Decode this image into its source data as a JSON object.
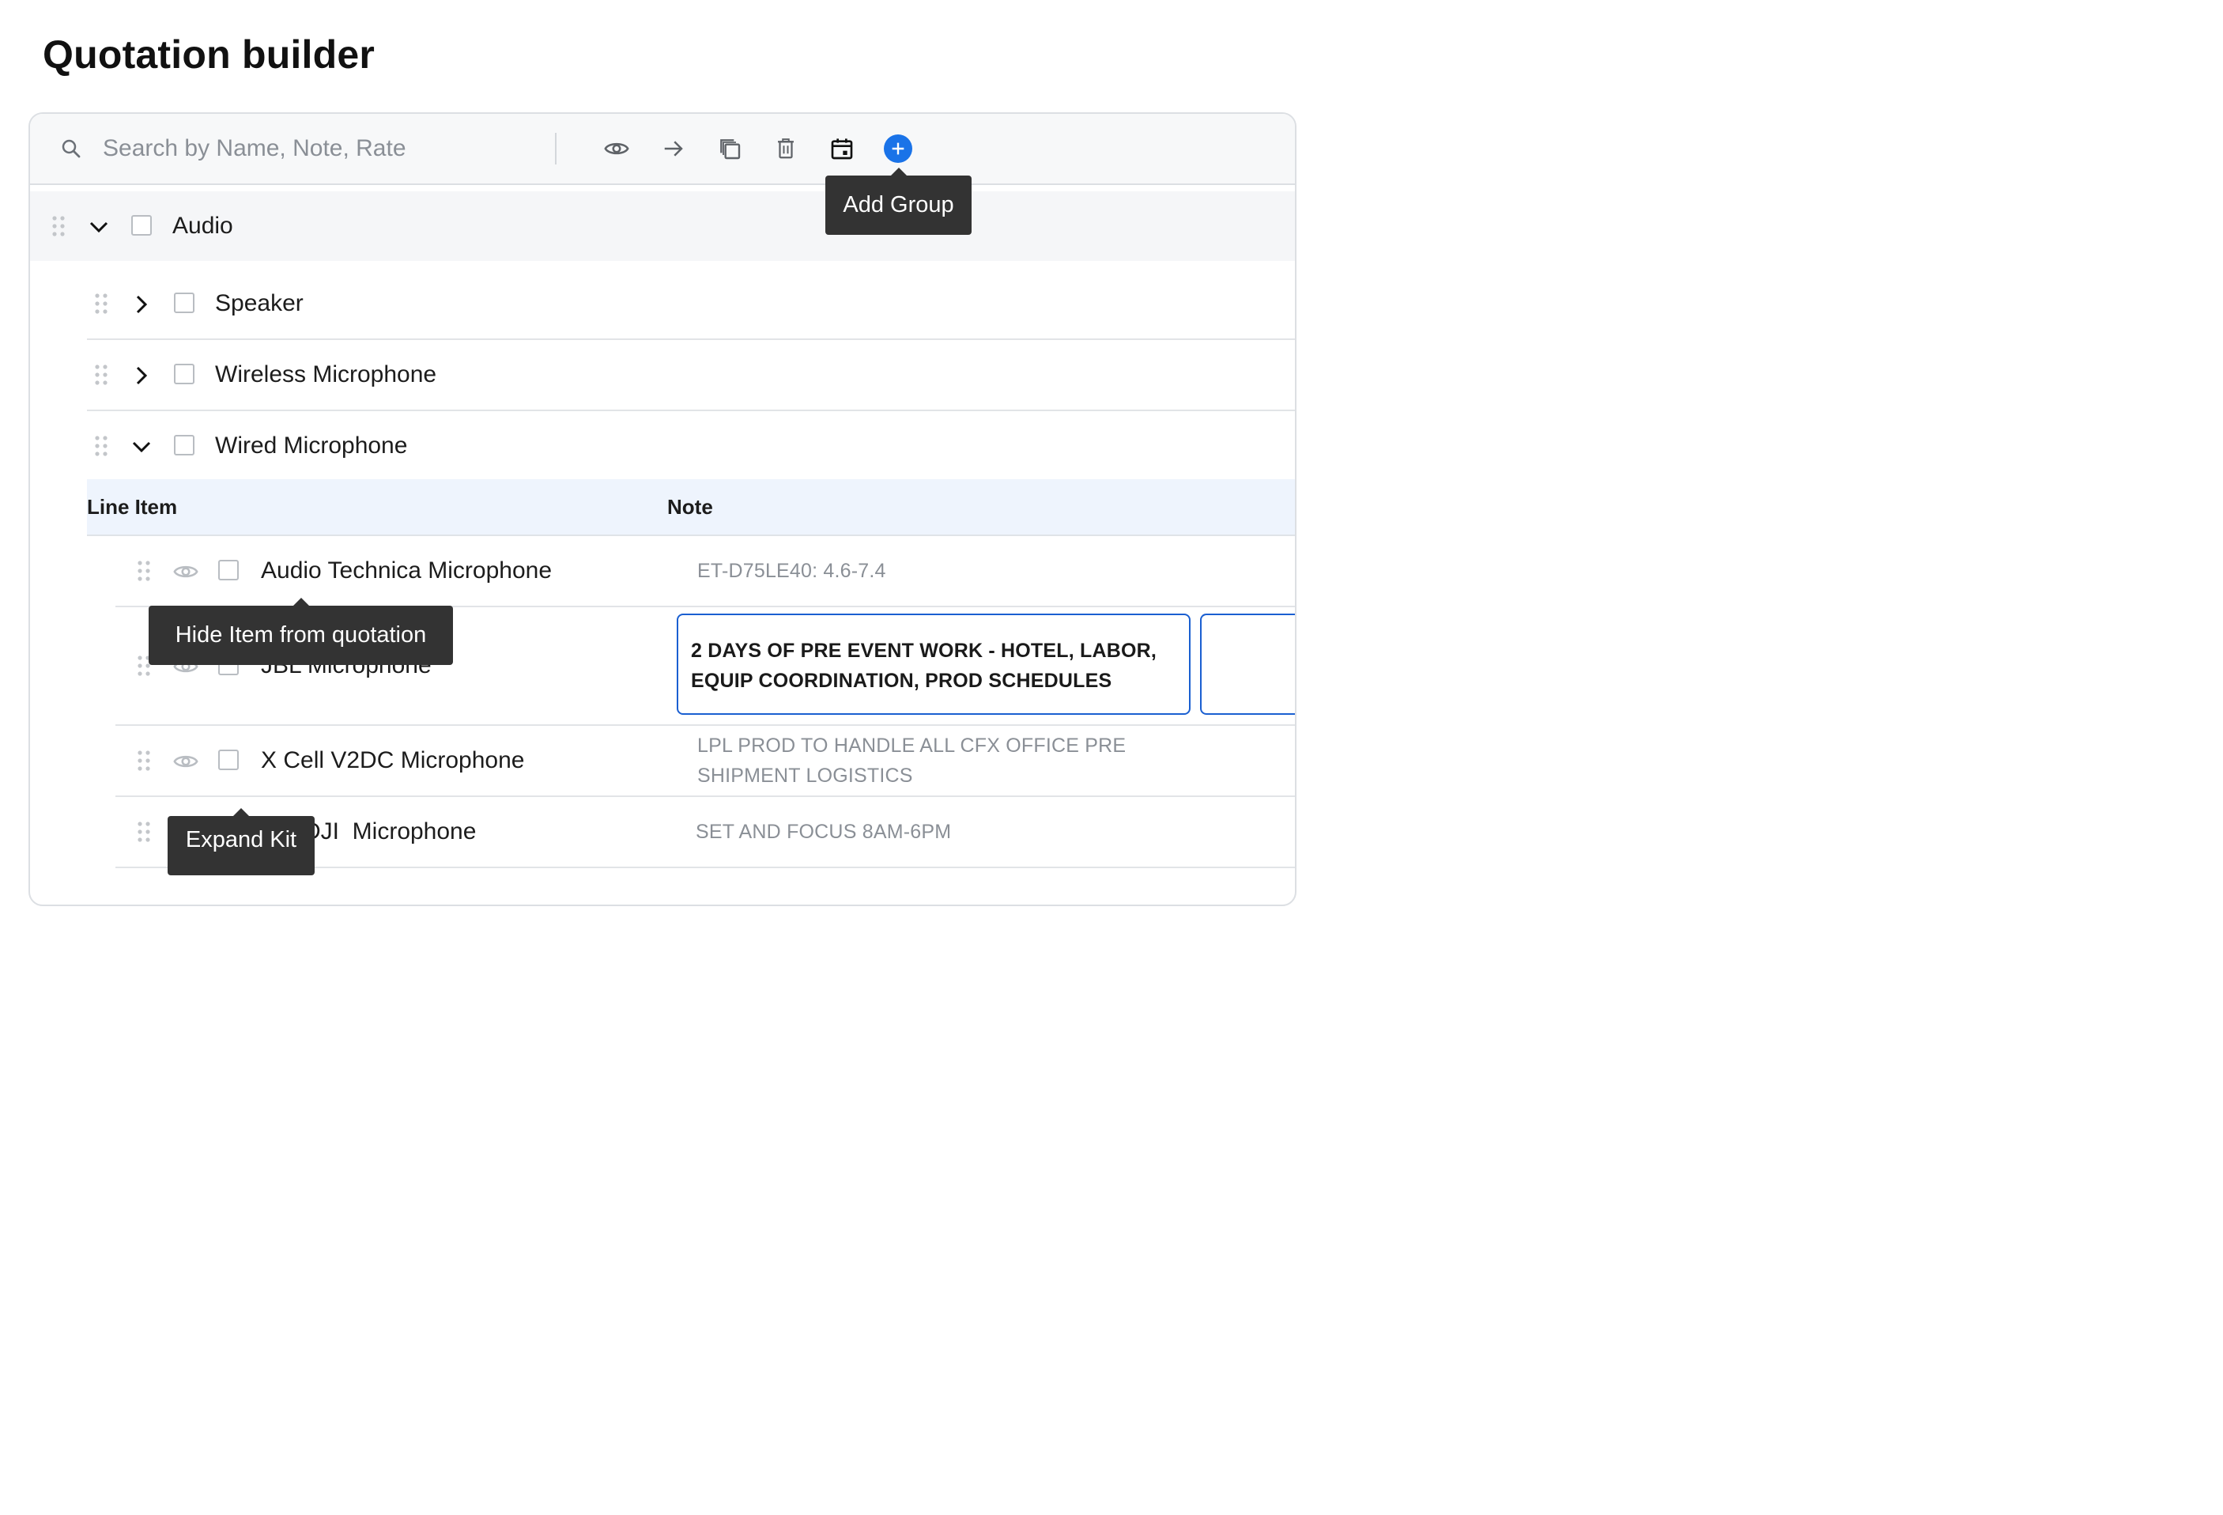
{
  "page": {
    "title": "Quotation builder"
  },
  "toolbar": {
    "search_placeholder": "Search by Name, Note, Rate",
    "icons": [
      "search-icon",
      "eye-icon",
      "arrow-right-icon",
      "copy-icon",
      "trash-icon",
      "calendar-icon",
      "plus-circle-icon"
    ],
    "accent_color": "#1a73e8"
  },
  "tooltips": {
    "add_group": "Add Group",
    "hide_item": "Hide Item from quotation",
    "expand_kit": "Expand Kit"
  },
  "group": {
    "label": "Audio",
    "expanded": true,
    "subgroups": [
      {
        "label": "Speaker",
        "expanded": false
      },
      {
        "label": "Wireless Microphone",
        "expanded": false
      },
      {
        "label": "Wired Microphone",
        "expanded": true
      }
    ]
  },
  "table": {
    "headers": {
      "line_item": "Line Item",
      "note": "Note"
    },
    "rows": [
      {
        "name": "Audio Technica Microphone",
        "note": "ET-D75LE40: 4.6-7.4"
      },
      {
        "name": "JBL Microphone",
        "note_line1": "2 DAYS OF PRE EVENT WORK - HOTEL, LABOR,",
        "note_line2": "EQUIP COORDINATION, PROD SCHEDULES",
        "editing": true
      },
      {
        "name": "X Cell V2DC Microphone",
        "note_line1": "LPL PROD TO HANDLE ALL CFX OFFICE PRE",
        "note_line2": "SHIPMENT LOGISTICS"
      },
      {
        "name": "DJI  Microphone",
        "note": "SET AND FOCUS 8AM-6PM"
      }
    ]
  }
}
